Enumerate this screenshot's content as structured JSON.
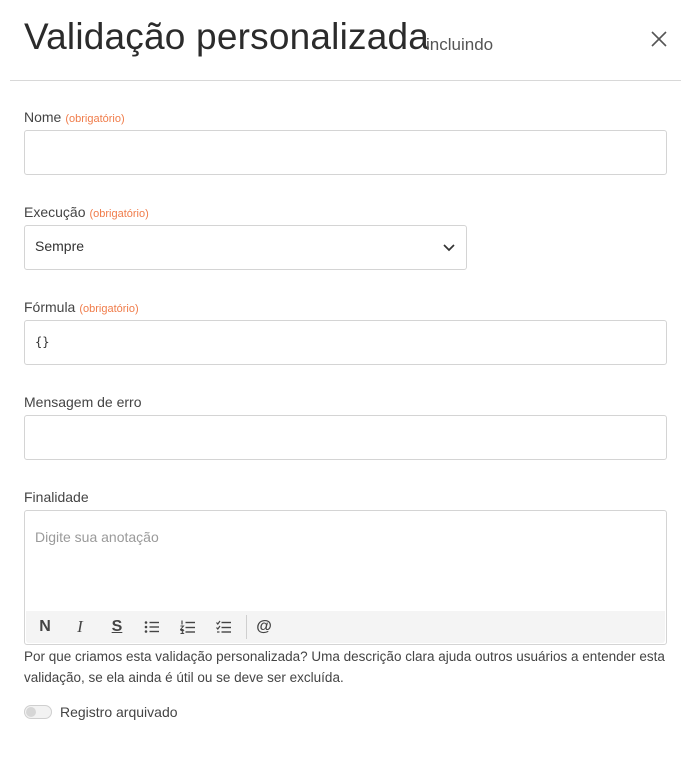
{
  "header": {
    "title": "Validação personalizada",
    "subtitle": "incluindo"
  },
  "required_tag": "(obrigatório)",
  "fields": {
    "name": {
      "label": "Nome",
      "value": ""
    },
    "execution": {
      "label": "Execução",
      "value": "Sempre"
    },
    "formula": {
      "label": "Fórmula",
      "value": "{}"
    },
    "error_message": {
      "label": "Mensagem de erro",
      "value": ""
    },
    "purpose": {
      "label": "Finalidade",
      "placeholder": "Digite sua anotação"
    }
  },
  "toolbar": {
    "bold": "N",
    "italic": "I",
    "strike": "S",
    "mention": "@",
    "icons": [
      "bold-icon",
      "italic-icon",
      "strikethrough-icon",
      "bullet-list-icon",
      "numbered-list-icon",
      "checklist-icon",
      "mention-icon"
    ]
  },
  "help_text": "Por que criamos esta validação personalizada? Uma descrição clara ajuda outros usuários a entender esta validação, se ela ainda é útil ou se deve ser excluída.",
  "archived": {
    "label": "Registro arquivado",
    "checked": false
  },
  "colors": {
    "required": "#f07c4a",
    "border": "#d4d4d4",
    "toolbar_bg": "#f4f4f4"
  }
}
